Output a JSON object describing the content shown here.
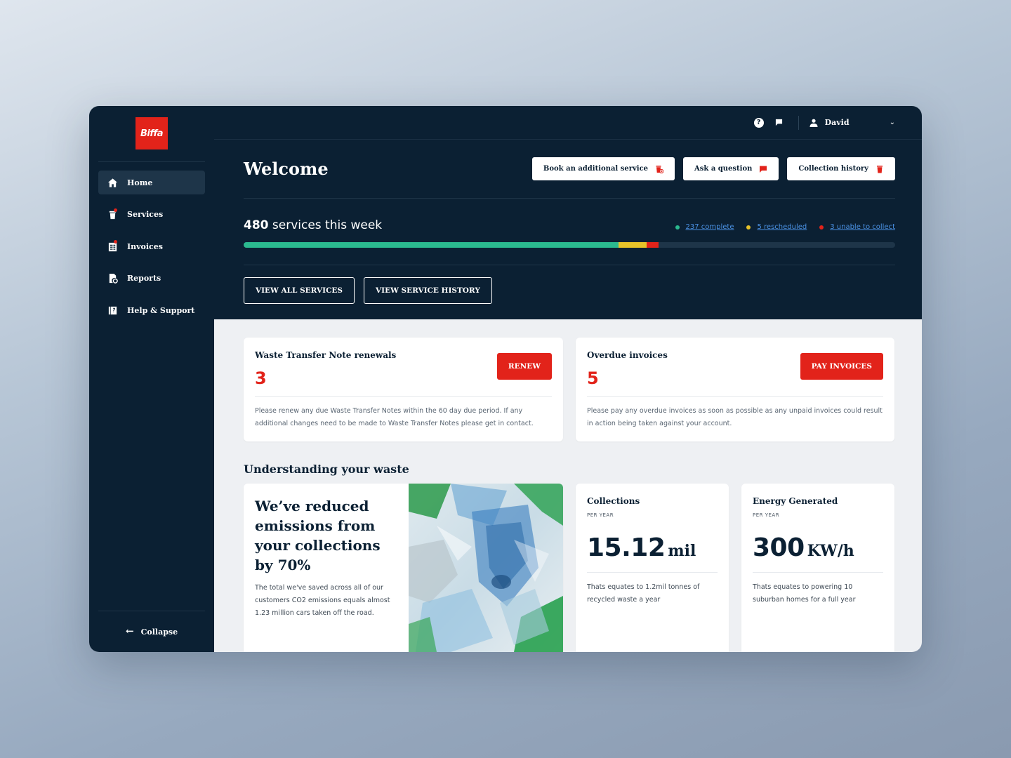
{
  "brand": {
    "logo_text": "Biffa",
    "accent": "#e2231a",
    "navy": "#0b2033"
  },
  "sidebar": {
    "items": [
      {
        "label": "Home",
        "icon": "home-icon",
        "active": true
      },
      {
        "label": "Services",
        "icon": "bin-icon",
        "badge": true
      },
      {
        "label": "Invoices",
        "icon": "invoice-icon",
        "badge": true
      },
      {
        "label": "Reports",
        "icon": "report-icon"
      },
      {
        "label": "Help & Support",
        "icon": "help-book-icon"
      }
    ],
    "collapse_label": "Collapse"
  },
  "topbar": {
    "help_icon": "help-circle-icon",
    "chat_icon": "flag-icon",
    "user_name": "David"
  },
  "hero": {
    "title": "Welcome",
    "buttons": {
      "book": "Book an additional service",
      "ask": "Ask a question",
      "history": "Collection history"
    },
    "stats": {
      "count": "480",
      "suffix": " services this week",
      "complete_label": "237 complete",
      "rescheduled_label": "5 rescheduled",
      "unable_label": "3 unable to collect",
      "total": 480,
      "complete": 237,
      "rescheduled": 5,
      "unable": 3,
      "colors": {
        "complete": "#2bb98f",
        "rescheduled": "#e6c229",
        "unable": "#e2231a"
      }
    },
    "view_all": "VIEW ALL SERVICES",
    "view_history": "VIEW SERVICE HISTORY"
  },
  "alerts": {
    "wtn": {
      "title": "Waste Transfer Note renewals",
      "count": "3",
      "button": "RENEW",
      "text": "Please renew any due Waste Transfer Notes within the 60 day due period. If any additional changes need to be made to Waste Transfer Notes please get in contact."
    },
    "overdue": {
      "title": "Overdue invoices",
      "count": "5",
      "button": "PAY INVOICES",
      "text": "Please pay any overdue invoices as soon as possible as any unpaid invoices could result in action being taken against your account."
    }
  },
  "waste": {
    "section_title": "Understanding your waste",
    "emissions": {
      "headline": "We’ve reduced emissions from your collections by 70%",
      "text": "The total we've saved across all of our customers CO2 emissions equals almost 1.23 million cars taken off the road."
    },
    "collections": {
      "title": "Collections",
      "sub": "PER YEAR",
      "value": "15.12",
      "unit": "mil",
      "text": "Thats equates to 1.2mil tonnes of recycled waste a year"
    },
    "energy": {
      "title": "Energy Generated",
      "sub": "PER YEAR",
      "value": "300",
      "unit": "KW/h",
      "text": "Thats equates to powering 10 suburban homes for a full year"
    }
  }
}
